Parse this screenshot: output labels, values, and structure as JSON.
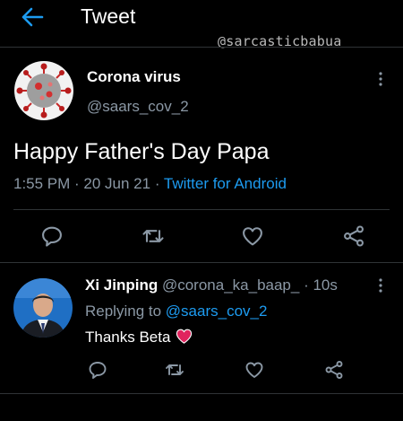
{
  "header": {
    "title": "Tweet",
    "back_icon": "back-arrow-icon",
    "accent": "#1d9bf0"
  },
  "watermark": "@sarcasticbabua",
  "tweet": {
    "author_name": "Corona virus",
    "author_handle": "@saars_cov_2",
    "text": "Happy Father's Day Papa",
    "time": "1:55 PM",
    "dot1": " · ",
    "date": "20 Jun 21",
    "dot2": " · ",
    "source": "Twitter for Android",
    "actions": [
      "reply-icon",
      "retweet-icon",
      "like-icon",
      "share-icon"
    ]
  },
  "reply": {
    "name": "Xi Jinping",
    "handle": "@corona_ka_baap_",
    "time_sep": " · ",
    "time": "10s",
    "replying_label": "Replying to ",
    "replying_to": "@saars_cov_2",
    "text": "Thanks Beta",
    "emoji": "❤️",
    "actions": [
      "reply-icon",
      "retweet-icon",
      "like-icon",
      "share-icon"
    ]
  },
  "colors": {
    "background": "#000000",
    "muted_text": "#8b98a5",
    "link": "#1d9bf0",
    "divider": "#2f3336"
  }
}
